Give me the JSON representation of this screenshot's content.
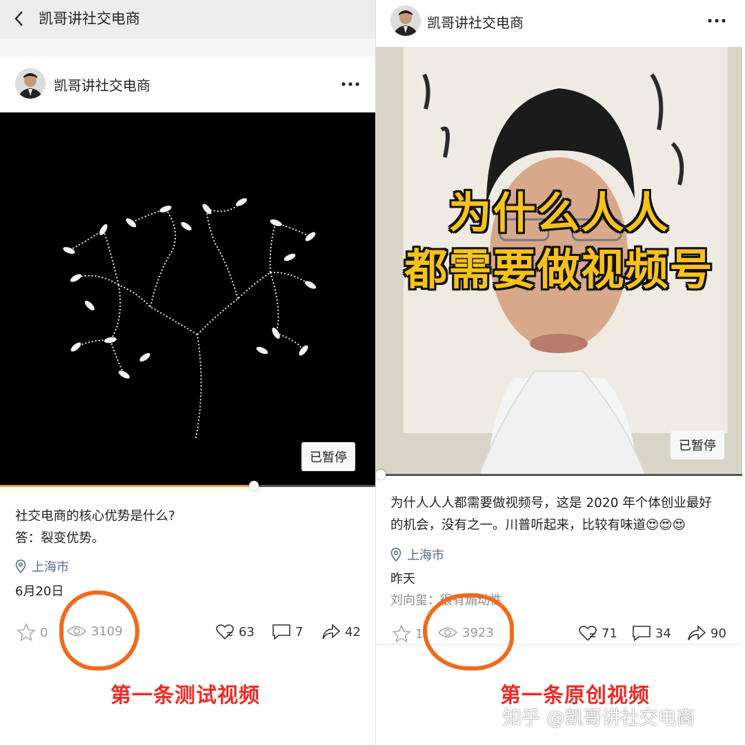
{
  "left": {
    "topbar_title": "凯哥讲社交电商",
    "username": "凯哥讲社交电商",
    "paused_label": "已暂停",
    "caption_line1": "社交电商的核心优势是什么?",
    "caption_line2": "答：裂变优势。",
    "location": "上海市",
    "date": "6月20日",
    "stats": {
      "favorites": "0",
      "views": "3109",
      "likes": "63",
      "comments": "7",
      "shares": "42"
    },
    "annotation": "第一条测试视频"
  },
  "right": {
    "username": "凯哥讲社交电商",
    "paused_label": "已暂停",
    "overlay_line1": "为什么人人",
    "overlay_line2": "都需要做视频号",
    "caption_line1": "为什人人人都需要做视频号，这是 2020 年个体创业最好",
    "caption_line2": "的机会，没有之一。川普听起来，比较有味道😍😍😍",
    "location": "上海市",
    "date": "昨天",
    "comment_preview": "刘向玺：很有煽动性",
    "stats": {
      "favorites": "1",
      "views": "3923",
      "likes": "71",
      "comments": "34",
      "shares": "90"
    },
    "annotation": "第一条原创视频"
  },
  "watermark": "知乎 @凯哥讲社交电商",
  "colors": {
    "annotation_red": "#ee2a24",
    "circle_orange": "#f06a1c",
    "progress": "#f4a13a",
    "overlay_yellow": "#f7c21a"
  }
}
